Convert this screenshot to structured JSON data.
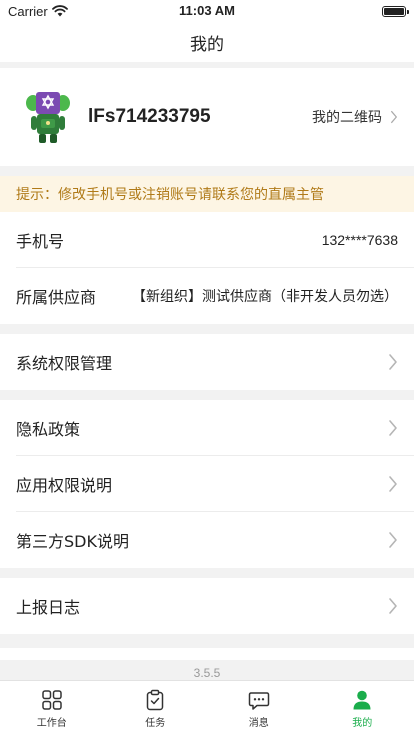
{
  "status_bar": {
    "carrier": "Carrier",
    "time": "11:03 AM"
  },
  "nav": {
    "title": "我的"
  },
  "profile": {
    "username": "lFs714233795",
    "qr_label": "我的二维码"
  },
  "tip": {
    "text": "提示：修改手机号或注销账号请联系您的直属主管"
  },
  "info": {
    "phone_label": "手机号",
    "phone_value": "132****7638",
    "supplier_label": "所属供应商",
    "supplier_value": "【新组织】测试供应商（非开发人员勿选）"
  },
  "menu": {
    "permission_mgmt": "系统权限管理",
    "privacy_policy": "隐私政策",
    "app_permission": "应用权限说明",
    "third_party_sdk": "第三方SDK说明",
    "report_log": "上报日志"
  },
  "version": "3.5.5",
  "tabs": [
    {
      "label": "工作台",
      "icon": "grid-icon"
    },
    {
      "label": "任务",
      "icon": "clipboard-check-icon"
    },
    {
      "label": "消息",
      "icon": "chat-bubble-icon"
    },
    {
      "label": "我的",
      "icon": "person-icon"
    }
  ],
  "colors": {
    "accent": "#1aad4b",
    "tip_bg": "#fdf5e4",
    "tip_text": "#b07a18"
  }
}
